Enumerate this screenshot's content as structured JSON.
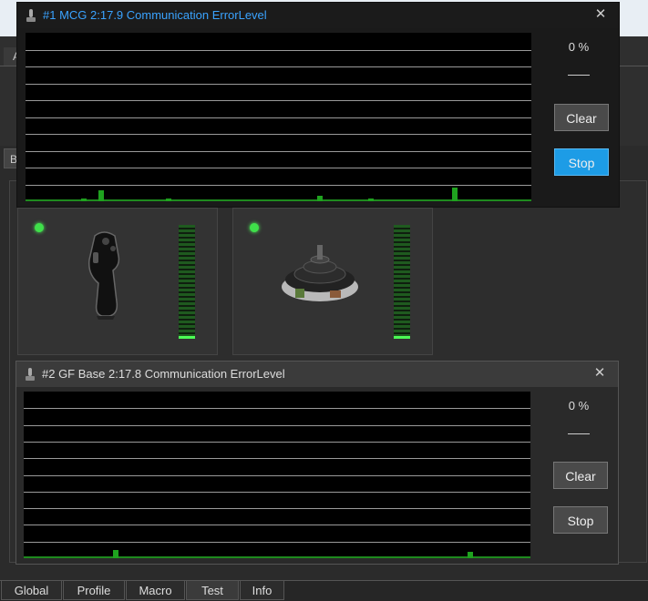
{
  "background": {
    "tab_label": "A",
    "button_label": "B"
  },
  "windows": [
    {
      "title": "#1 MCG  2:17.9  Communication ErrorLevel",
      "title_color": "#3aa3ff",
      "close_symbol": "✕",
      "percent": "0 %",
      "clear_label": "Clear",
      "stop_label": "Stop",
      "error_spikes": [
        {
          "index": 3,
          "level": 0.2
        },
        {
          "index": 4,
          "level": 0.75
        },
        {
          "index": 8,
          "level": 0.15
        },
        {
          "index": 17,
          "level": 0.35
        },
        {
          "index": 20,
          "level": 0.15
        },
        {
          "index": 25,
          "level": 0.95
        }
      ]
    },
    {
      "title": "#2 GF Base  2:17.8  Communication ErrorLevel",
      "title_color": "#dddddd",
      "close_symbol": "✕",
      "percent": "0 %",
      "clear_label": "Clear",
      "stop_label": "Stop",
      "error_spikes": [
        {
          "index": 5,
          "level": 0.55
        },
        {
          "index": 26,
          "level": 0.45
        }
      ]
    }
  ],
  "devices": [
    {
      "name": "joystick-grip",
      "status": "connected",
      "level": 0.02
    },
    {
      "name": "joystick-base",
      "status": "connected",
      "level": 0.02
    }
  ],
  "tabs": [
    {
      "label": "Global",
      "active": false
    },
    {
      "label": "Profile",
      "active": false
    },
    {
      "label": "Macro",
      "active": false
    },
    {
      "label": "Test",
      "active": true
    },
    {
      "label": "Info",
      "active": false
    }
  ],
  "colors": {
    "accent": "#1d9ce6",
    "led": "#3fe04a",
    "graph_baseline": "#1e8a1e"
  }
}
